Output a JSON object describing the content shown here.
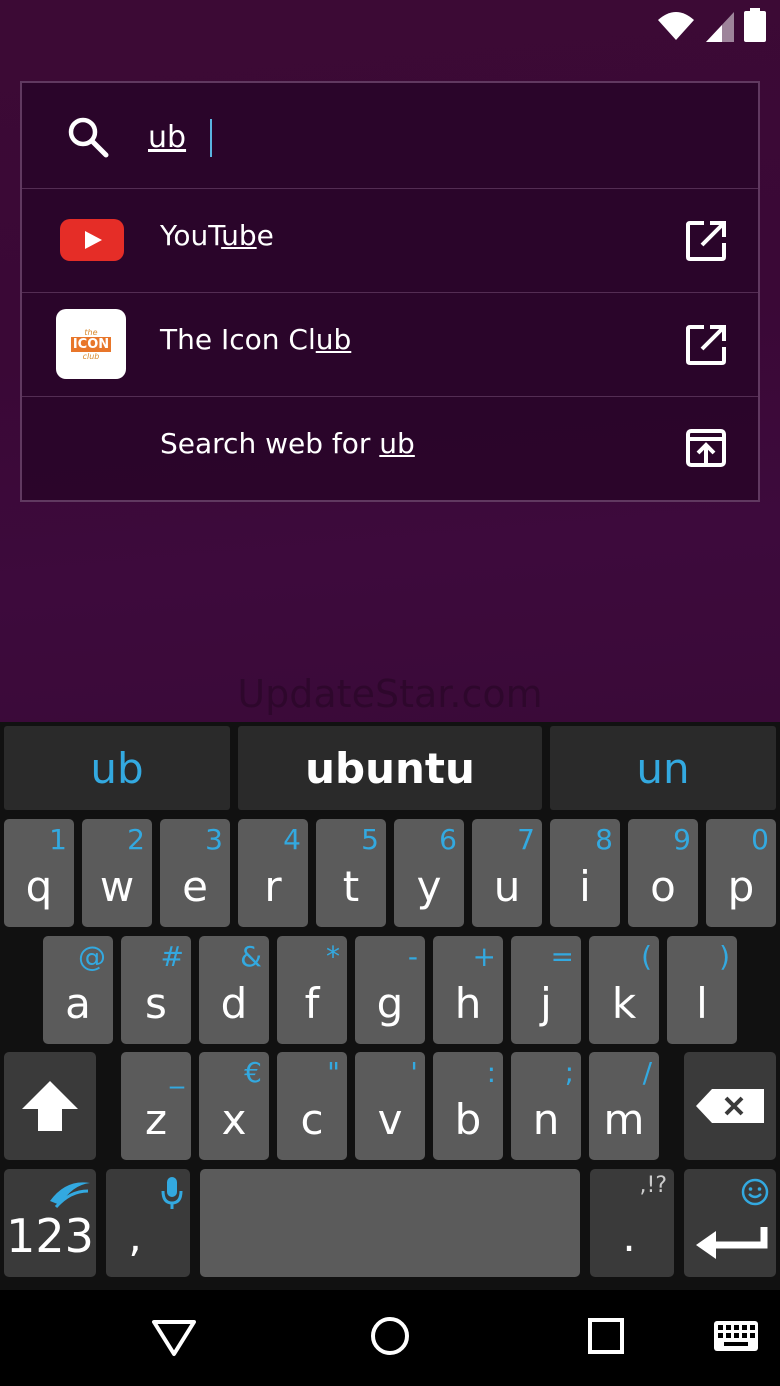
{
  "search": {
    "query": "ub"
  },
  "results": [
    {
      "before": "YouT",
      "match": "ub",
      "after": "e",
      "icon": "youtube-app-icon"
    },
    {
      "before": "The Icon Cl",
      "match": "ub",
      "after": "",
      "icon": "icon-club-app-icon"
    },
    {
      "before": "Search web for ",
      "match": "ub",
      "after": "",
      "icon": "none"
    }
  ],
  "icon_club_logo": {
    "line1": "the",
    "line2": "ICON",
    "line3": "club"
  },
  "watermark": "UpdateStar.com",
  "keyboard": {
    "suggestions": [
      "ub",
      "ubuntu",
      "un"
    ],
    "row1": [
      {
        "k": "q",
        "s": "1"
      },
      {
        "k": "w",
        "s": "2"
      },
      {
        "k": "e",
        "s": "3"
      },
      {
        "k": "r",
        "s": "4"
      },
      {
        "k": "t",
        "s": "5"
      },
      {
        "k": "y",
        "s": "6"
      },
      {
        "k": "u",
        "s": "7"
      },
      {
        "k": "i",
        "s": "8"
      },
      {
        "k": "o",
        "s": "9"
      },
      {
        "k": "p",
        "s": "0"
      }
    ],
    "row2": [
      {
        "k": "a",
        "s": "@"
      },
      {
        "k": "s",
        "s": "#"
      },
      {
        "k": "d",
        "s": "&"
      },
      {
        "k": "f",
        "s": "*"
      },
      {
        "k": "g",
        "s": "-"
      },
      {
        "k": "h",
        "s": "+"
      },
      {
        "k": "j",
        "s": "="
      },
      {
        "k": "k",
        "s": "("
      },
      {
        "k": "l",
        "s": ")"
      }
    ],
    "row3": [
      {
        "k": "z",
        "s": "_"
      },
      {
        "k": "x",
        "s": "€"
      },
      {
        "k": "c",
        "s": "\""
      },
      {
        "k": "v",
        "s": "'"
      },
      {
        "k": "b",
        "s": ":"
      },
      {
        "k": "n",
        "s": ";"
      },
      {
        "k": "m",
        "s": "/"
      }
    ],
    "numbers_label": "123",
    "comma_label": ",",
    "period_label": ".",
    "period_secondary": ",!?"
  },
  "colors": {
    "accent": "#33a9e0",
    "key": "#5b5b5b",
    "key_dark": "#3a3a3a",
    "youtube_red": "#e52d27"
  }
}
